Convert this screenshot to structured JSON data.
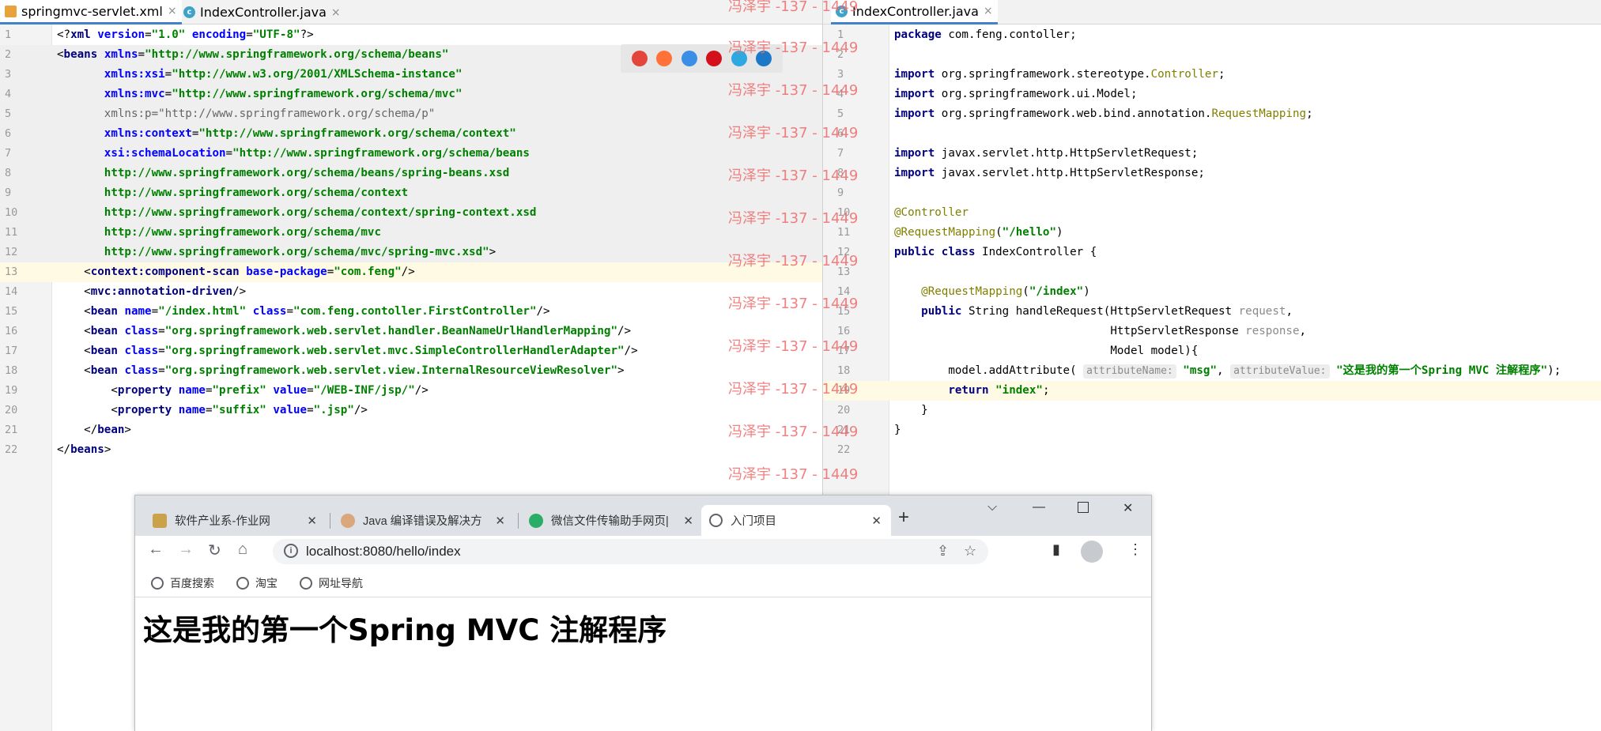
{
  "ide": {
    "left": {
      "tabs": [
        {
          "label": "springmvc-servlet.xml",
          "icon": "xml-file-icon"
        },
        {
          "label": "IndexController.java",
          "icon": "java-class-icon"
        }
      ],
      "line_numbers": [
        "1",
        "2",
        "3",
        "4",
        "5",
        "6",
        "7",
        "8",
        "9",
        "10",
        "11",
        "12",
        "13",
        "14",
        "15",
        "16",
        "17",
        "18",
        "19",
        "20",
        "21",
        "22"
      ]
    },
    "right": {
      "tabs": [
        {
          "label": "IndexController.java",
          "icon": "java-class-icon"
        }
      ],
      "line_numbers": [
        "1",
        "2",
        "3",
        "4",
        "5",
        "6",
        "7",
        "8",
        "9",
        "10",
        "11",
        "12",
        "13",
        "14",
        "15",
        "16",
        "17",
        "18",
        "19",
        "20",
        "21",
        "22"
      ]
    },
    "hints": {
      "attributeName": "attributeName:",
      "attributeValue": "attributeValue:"
    }
  },
  "watermark": "冯泽宇 -137 - 1449",
  "browser": {
    "tabs": [
      {
        "label": "软件产业系-作业网"
      },
      {
        "label": "Java 编译错误及解决方"
      },
      {
        "label": "微信文件传输助手网页|"
      },
      {
        "label": "入门项目"
      }
    ],
    "url": "localhost:8080/hello/index",
    "bookmarks": [
      "百度搜索",
      "淘宝",
      "网址导航"
    ],
    "heading": "这是我的第一个Spring MVC 注解程序"
  },
  "colors": {
    "tag": "#000080",
    "attribute": "#0000ff",
    "string": "#008000",
    "annotation": "#808000",
    "watermark": "#f06a6a",
    "current_line": "#fffae3"
  }
}
